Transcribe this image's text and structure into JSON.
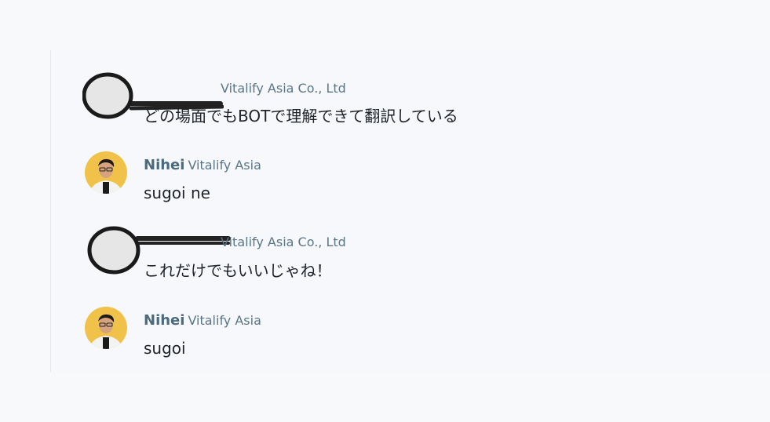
{
  "messages": [
    {
      "sender": "",
      "company": "Vitalify Asia Co., Ltd",
      "text": "どの場面でもBOTで理解できて翻訳している",
      "avatar": "redacted-avatar"
    },
    {
      "sender": "Nihei",
      "company": "Vitalify Asia",
      "text": "sugoi ne",
      "avatar": "user-photo"
    },
    {
      "sender": "",
      "company": "Vitalify Asia Co., Ltd",
      "text": "これだけでもいいじゃね！",
      "avatar": "redacted-avatar"
    },
    {
      "sender": "Nihei",
      "company": "Vitalify Asia",
      "text": "sugoi",
      "avatar": "user-photo"
    }
  ],
  "colors": {
    "sender": "#4a6a7e",
    "company": "#5a7586",
    "text": "#1f2328",
    "background": "#f6f8fb",
    "avatar_ring": "#f0c24a"
  }
}
